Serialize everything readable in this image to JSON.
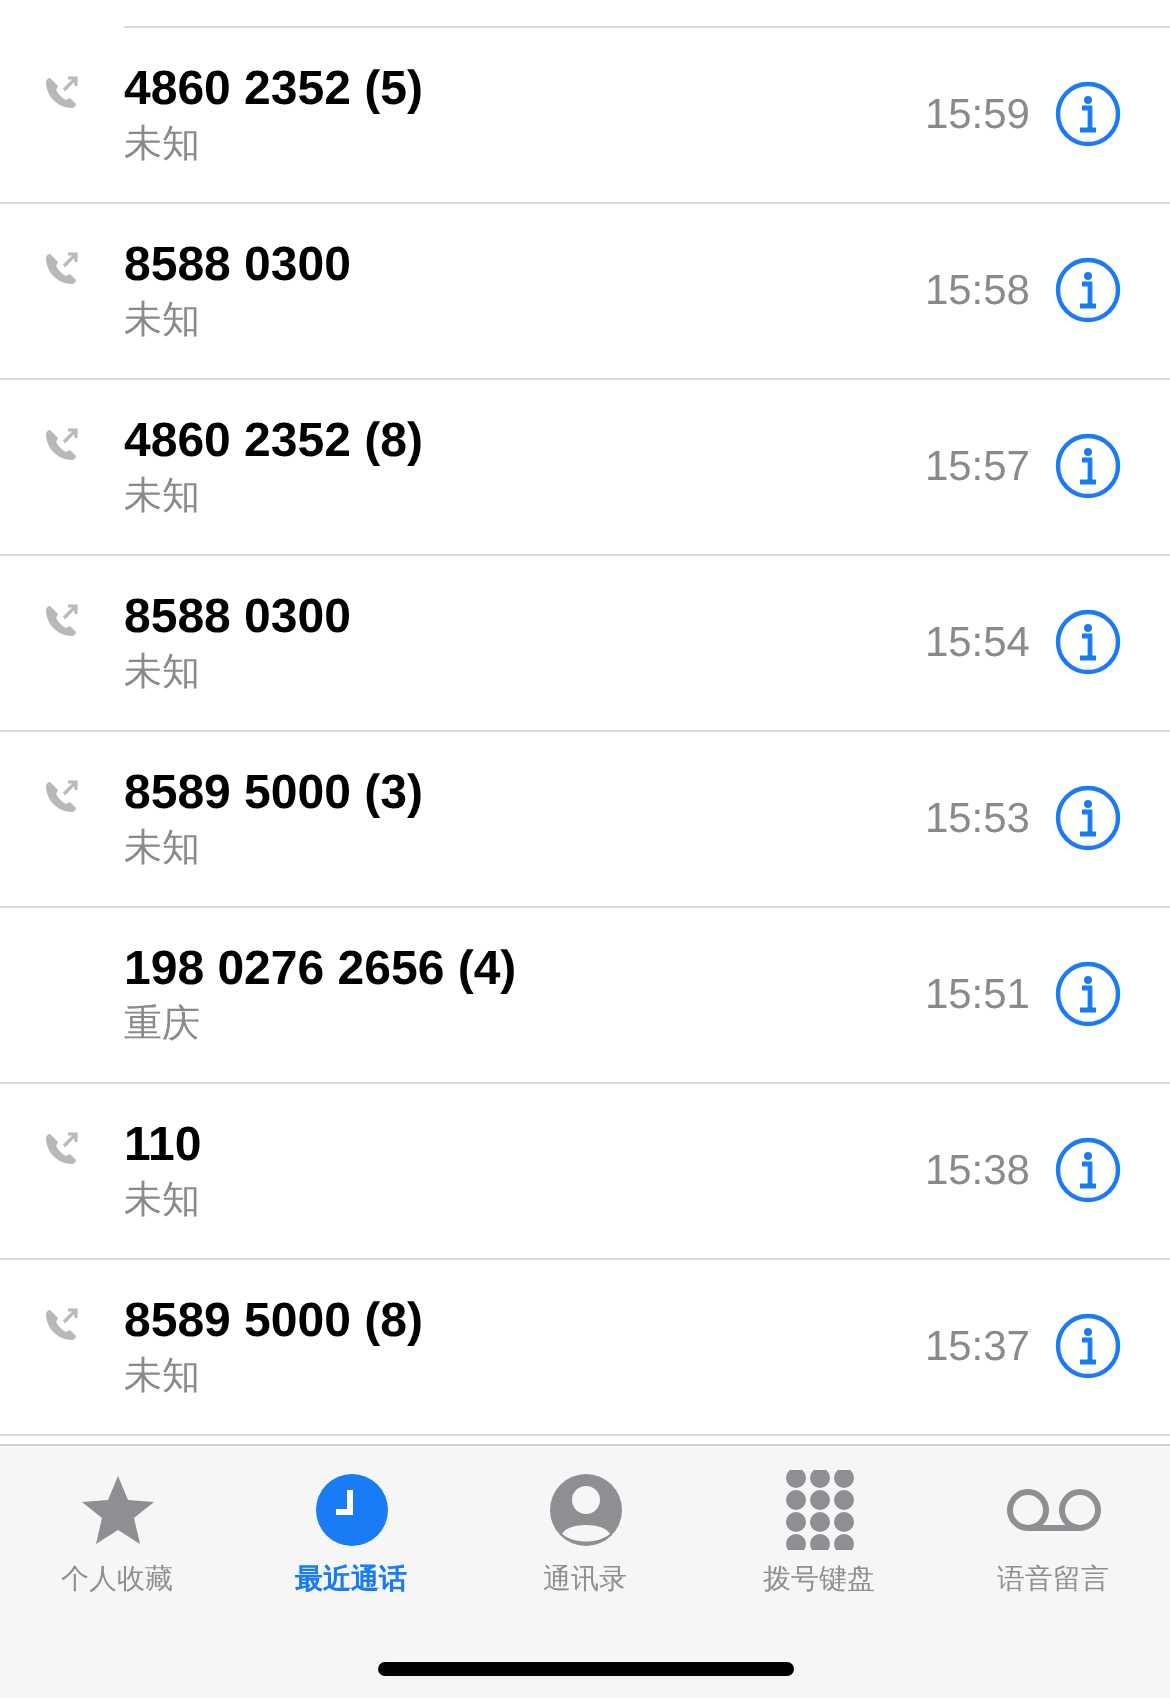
{
  "calls": [
    {
      "number": "4860 2352 (5)",
      "label": "未知",
      "time": "15:59",
      "outgoing": true
    },
    {
      "number": "8588 0300",
      "label": "未知",
      "time": "15:58",
      "outgoing": true
    },
    {
      "number": "4860 2352 (8)",
      "label": "未知",
      "time": "15:57",
      "outgoing": true
    },
    {
      "number": "8588 0300",
      "label": "未知",
      "time": "15:54",
      "outgoing": true
    },
    {
      "number": "8589 5000 (3)",
      "label": "未知",
      "time": "15:53",
      "outgoing": true
    },
    {
      "number": "198 0276 2656 (4)",
      "label": "重庆",
      "time": "15:51",
      "outgoing": false
    },
    {
      "number": "110",
      "label": "未知",
      "time": "15:38",
      "outgoing": true
    },
    {
      "number": "8589 5000 (8)",
      "label": "未知",
      "time": "15:37",
      "outgoing": true
    }
  ],
  "tab_bar": [
    {
      "kind": "favorites",
      "label": "个人收藏",
      "selected": false
    },
    {
      "kind": "recents",
      "label": "最近通话",
      "selected": true
    },
    {
      "kind": "contacts",
      "label": "通讯录",
      "selected": false
    },
    {
      "kind": "keypad",
      "label": "拨号键盘",
      "selected": false
    },
    {
      "kind": "voicemail",
      "label": "语音留言",
      "selected": false
    }
  ]
}
